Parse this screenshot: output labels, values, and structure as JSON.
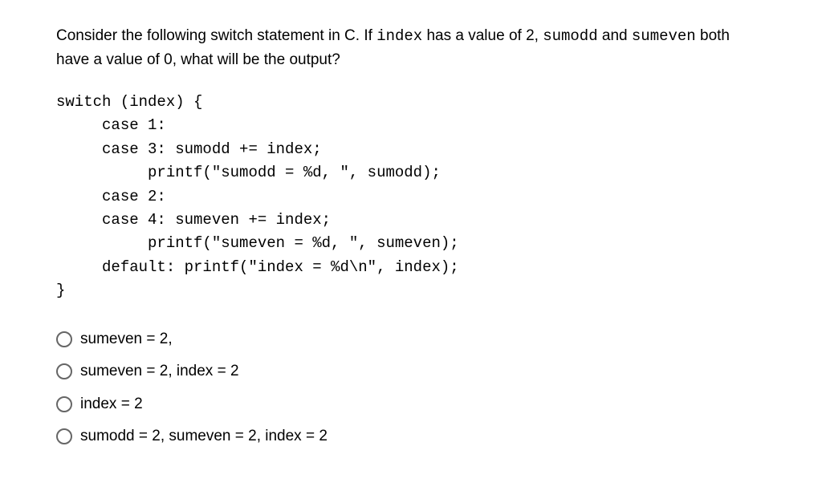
{
  "question": {
    "part1": "Consider the following switch statement in C. If ",
    "code1": "index",
    "part2": " has a value of 2, ",
    "code2": "sumodd",
    "part3": " and ",
    "code3": "sumeven",
    "part4": " both have a value of 0, what will be the output?"
  },
  "code": "switch (index) {\n     case 1:\n     case 3: sumodd += index;\n          printf(\"sumodd = %d, \", sumodd);\n     case 2:\n     case 4: sumeven += index;\n          printf(\"sumeven = %d, \", sumeven);\n     default: printf(\"index = %d\\n\", index);\n}",
  "options": [
    "sumeven = 2,",
    "sumeven = 2, index = 2",
    "index = 2",
    "sumodd = 2, sumeven = 2, index = 2"
  ]
}
